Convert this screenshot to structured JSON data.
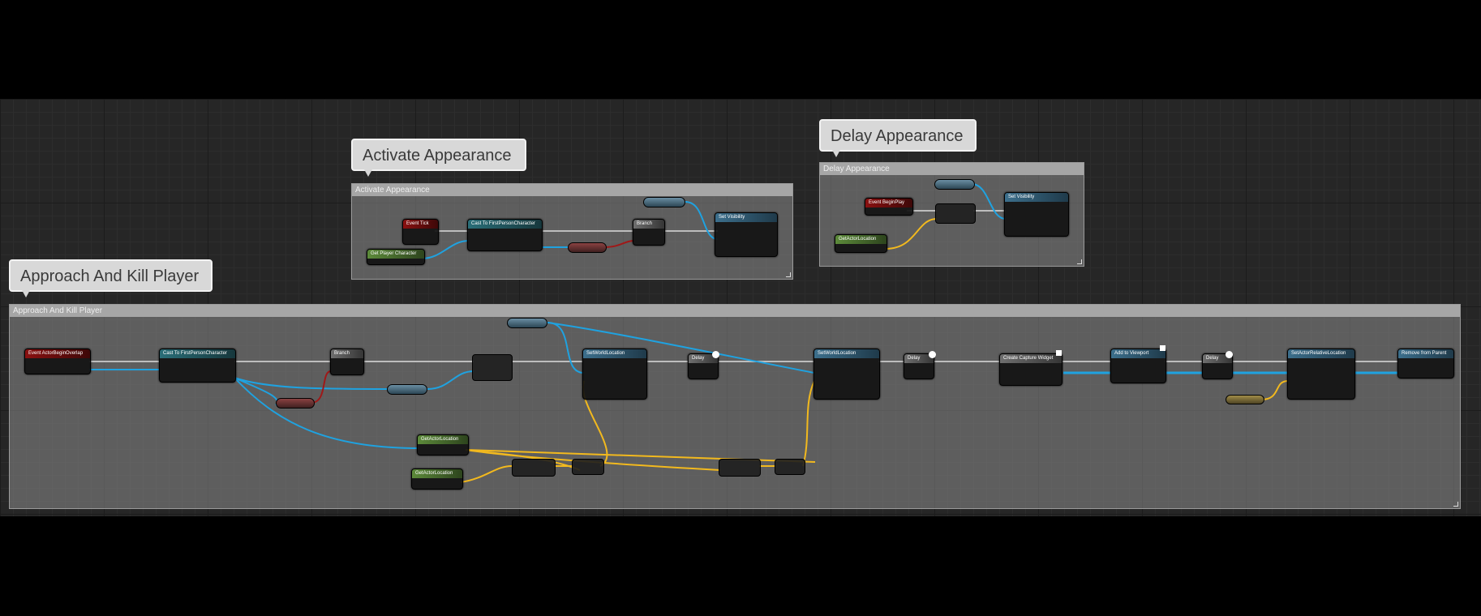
{
  "graph": {
    "comments": [
      {
        "bubble": "Activate Appearance",
        "header": "Activate Appearance"
      },
      {
        "bubble": "Delay Appearance",
        "header": "Delay Appearance"
      },
      {
        "bubble": "Approach And Kill Player",
        "header": "Approach And Kill Player"
      }
    ],
    "nodes": {
      "event_tick": "Event Tick",
      "cast_first_person_1": "Cast To FirstPersonCharacter",
      "get_player_character": "Get Player Character",
      "branch_1": "Branch",
      "set_visibility_1": "Set Visibility",
      "event_begin_play": "Event BeginPlay",
      "set_visibility_2": "Set Visibility",
      "get_actor_location_delay": "GetActorLocation",
      "actor_begin_overlap": "Event ActorBeginOverlap",
      "cast_first_person_2": "Cast To FirstPersonCharacter",
      "branch_2": "Branch",
      "set_world_location_1": "SetWorldLocation",
      "delay_1": "Delay",
      "set_world_location_2": "SetWorldLocation",
      "delay_2": "Delay",
      "create_widget": "Create Capture Widget",
      "add_to_viewport": "Add to Viewport",
      "delay_3": "Delay",
      "set_actor_relative_location": "SetActorRelativeLocation",
      "remove_from_parent": "Remove from Parent",
      "get_actor_location_a": "GetActorLocation",
      "get_actor_location_b": "GetActorLocation"
    }
  },
  "colors": {
    "exec_wire": "#bdbdbd",
    "object_wire": "#1fa2e0",
    "vector_wire": "#f2b91e",
    "bool_wire": "#a01818"
  }
}
